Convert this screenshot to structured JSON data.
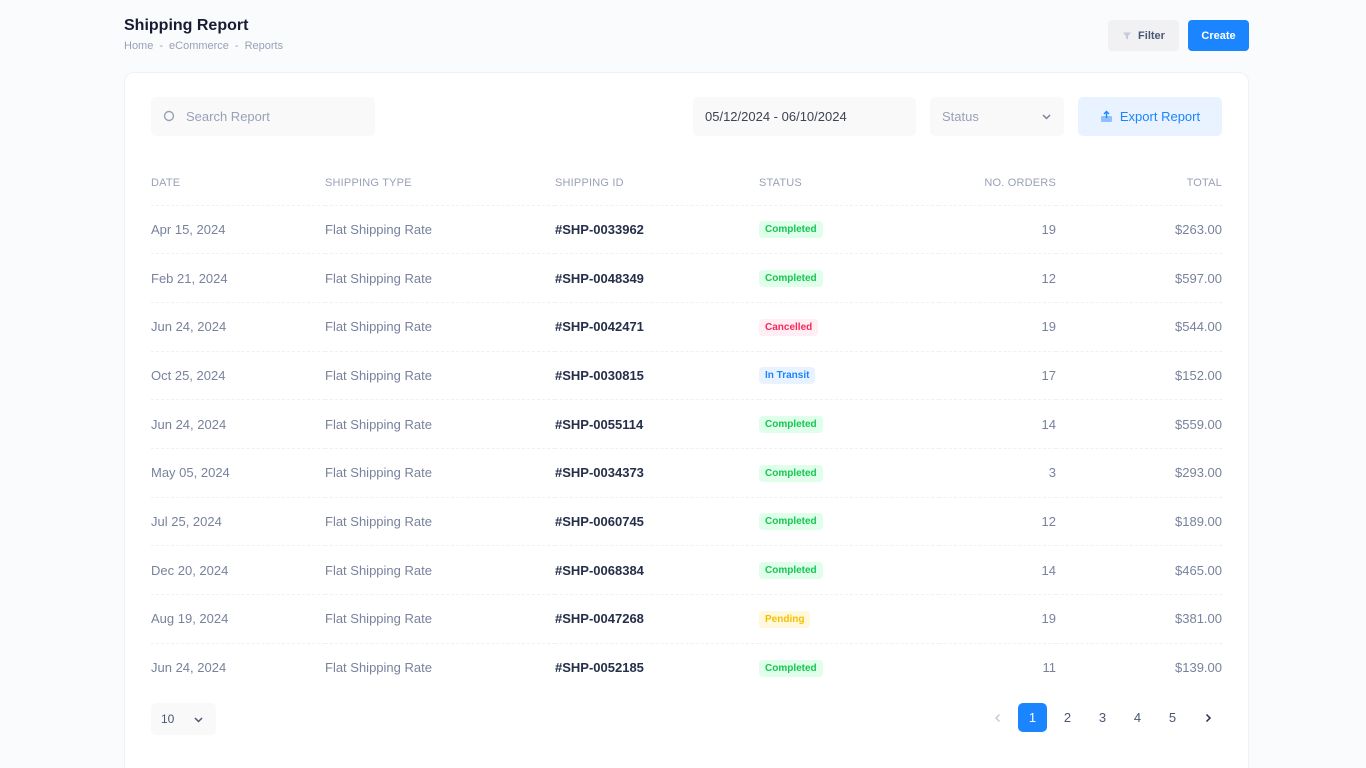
{
  "header": {
    "title": "Shipping Report",
    "breadcrumb": [
      "Home",
      "eCommerce",
      "Reports"
    ],
    "filter_label": "Filter",
    "create_label": "Create"
  },
  "toolbar": {
    "search_placeholder": "Search Report",
    "date_range": "05/12/2024 - 06/10/2024",
    "status_placeholder": "Status",
    "export_label": "Export Report"
  },
  "table": {
    "columns": [
      "Date",
      "Shipping Type",
      "Shipping ID",
      "Status",
      "No. Orders",
      "Total"
    ],
    "rows": [
      {
        "date": "Apr 15, 2024",
        "type": "Flat Shipping Rate",
        "id": "#SHP-0033962",
        "status": "Completed",
        "orders": "19",
        "total": "$263.00"
      },
      {
        "date": "Feb 21, 2024",
        "type": "Flat Shipping Rate",
        "id": "#SHP-0048349",
        "status": "Completed",
        "orders": "12",
        "total": "$597.00"
      },
      {
        "date": "Jun 24, 2024",
        "type": "Flat Shipping Rate",
        "id": "#SHP-0042471",
        "status": "Cancelled",
        "orders": "19",
        "total": "$544.00"
      },
      {
        "date": "Oct 25, 2024",
        "type": "Flat Shipping Rate",
        "id": "#SHP-0030815",
        "status": "In Transit",
        "orders": "17",
        "total": "$152.00"
      },
      {
        "date": "Jun 24, 2024",
        "type": "Flat Shipping Rate",
        "id": "#SHP-0055114",
        "status": "Completed",
        "orders": "14",
        "total": "$559.00"
      },
      {
        "date": "May 05, 2024",
        "type": "Flat Shipping Rate",
        "id": "#SHP-0034373",
        "status": "Completed",
        "orders": "3",
        "total": "$293.00"
      },
      {
        "date": "Jul 25, 2024",
        "type": "Flat Shipping Rate",
        "id": "#SHP-0060745",
        "status": "Completed",
        "orders": "12",
        "total": "$189.00"
      },
      {
        "date": "Dec 20, 2024",
        "type": "Flat Shipping Rate",
        "id": "#SHP-0068384",
        "status": "Completed",
        "orders": "14",
        "total": "$465.00"
      },
      {
        "date": "Aug 19, 2024",
        "type": "Flat Shipping Rate",
        "id": "#SHP-0047268",
        "status": "Pending",
        "orders": "19",
        "total": "$381.00"
      },
      {
        "date": "Jun 24, 2024",
        "type": "Flat Shipping Rate",
        "id": "#SHP-0052185",
        "status": "Completed",
        "orders": "11",
        "total": "$139.00"
      }
    ]
  },
  "footer": {
    "page_size": "10",
    "pages": [
      "1",
      "2",
      "3",
      "4",
      "5"
    ],
    "current_page": "1"
  },
  "colors": {
    "primary": "#1b84ff",
    "completed": "#17c653",
    "cancelled": "#f8285a",
    "transit": "#1b84ff",
    "pending": "#f6c000"
  },
  "icons": {
    "filter": "filter-icon",
    "search": "search-icon",
    "status_dropdown": "chevron-down-icon",
    "export": "export-icon",
    "page_size_dropdown": "chevron-down-icon",
    "prev": "chevron-left-icon",
    "next": "chevron-right-icon"
  }
}
